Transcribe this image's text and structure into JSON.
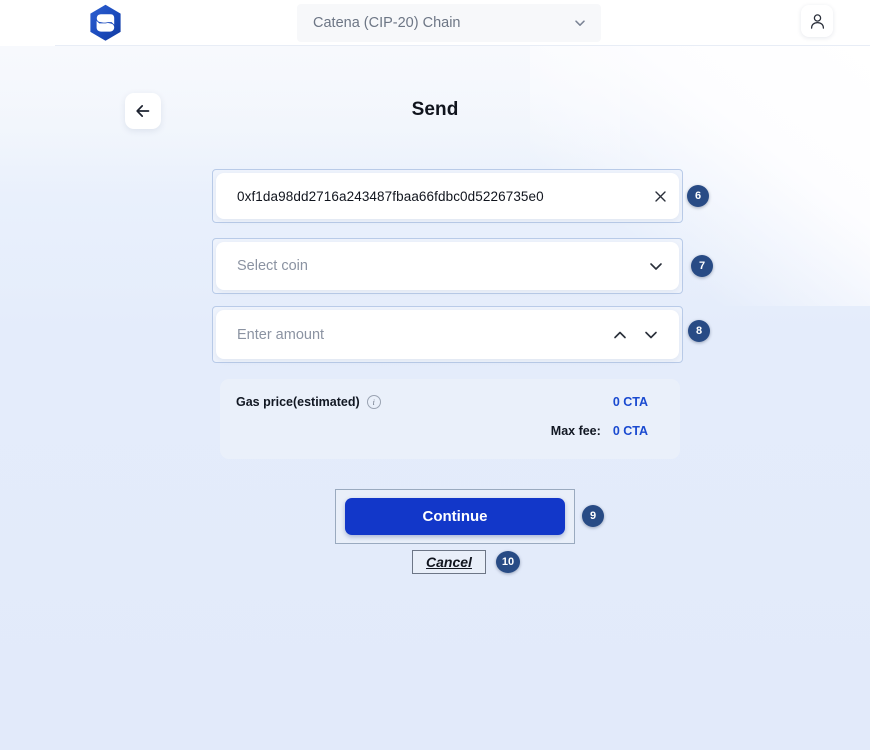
{
  "header": {
    "logo_icon": "catena-hexagon-logo",
    "chain_selector": {
      "selected": "Catena (CIP-20) Chain",
      "chevron_icon": "chevron-down-icon"
    },
    "account_icon": "user-person-icon"
  },
  "nav": {
    "back_icon": "arrow-left-icon",
    "title": "Send"
  },
  "form": {
    "address": {
      "value": "0xf1da98dd2716a243487fbaa66fdbc0d5226735e0",
      "clear_icon": "close-x-icon",
      "badge": "6"
    },
    "coin": {
      "placeholder": "Select coin",
      "chevron_icon": "chevron-down-icon",
      "badge": "7"
    },
    "amount": {
      "placeholder": "Enter amount",
      "increment_icon": "chevron-up-icon",
      "decrement_icon": "chevron-down-icon",
      "badge": "8"
    }
  },
  "gas": {
    "label": "Gas price(estimated)",
    "info_icon": "info-circle-icon",
    "info_glyph": "i",
    "value": "0 CTA",
    "max_fee_label": "Max fee:",
    "max_fee_value": "0 CTA"
  },
  "actions": {
    "continue_label": "Continue",
    "continue_badge": "9",
    "cancel_label": "Cancel",
    "cancel_badge": "10"
  },
  "colors": {
    "primary_button": "#1237c9",
    "badge": "#284b85",
    "gas_value": "#1a4ad0",
    "page_background": "#e4ecfb",
    "field_ring": "#b9cbe8"
  }
}
